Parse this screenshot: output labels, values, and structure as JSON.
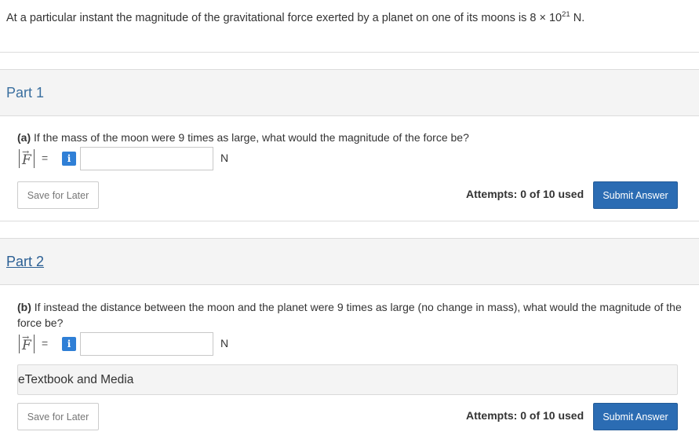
{
  "problem": {
    "text_before": "At a particular instant the magnitude of the gravitational force exerted by a planet on one of its moons is 8 × 10",
    "exponent": "21",
    "text_after": " N."
  },
  "parts": [
    {
      "title": "Part 1",
      "question_prefix": "(a)",
      "question_text": " If the mass of the moon were 9 times as large, what would the magnitude of the force be?",
      "symbol": "F",
      "arrow": "→",
      "equals": "=",
      "info": "i",
      "input_value": "",
      "unit": "N",
      "save_label": "Save for Later",
      "attempts_label": "Attempts: 0 of 10 used",
      "submit_label": "Submit Answer"
    },
    {
      "title": "Part 2",
      "question_prefix": "(b)",
      "question_text": " If instead the distance between the moon and the planet were 9 times as large (no change in mass), what would the magnitude of the force be?",
      "symbol": "F",
      "arrow": "→",
      "equals": "=",
      "info": "i",
      "input_value": "",
      "unit": "N",
      "etextbook_label": "eTextbook and Media",
      "save_label": "Save for Later",
      "attempts_label": "Attempts: 0 of 10 used",
      "submit_label": "Submit Answer"
    }
  ]
}
